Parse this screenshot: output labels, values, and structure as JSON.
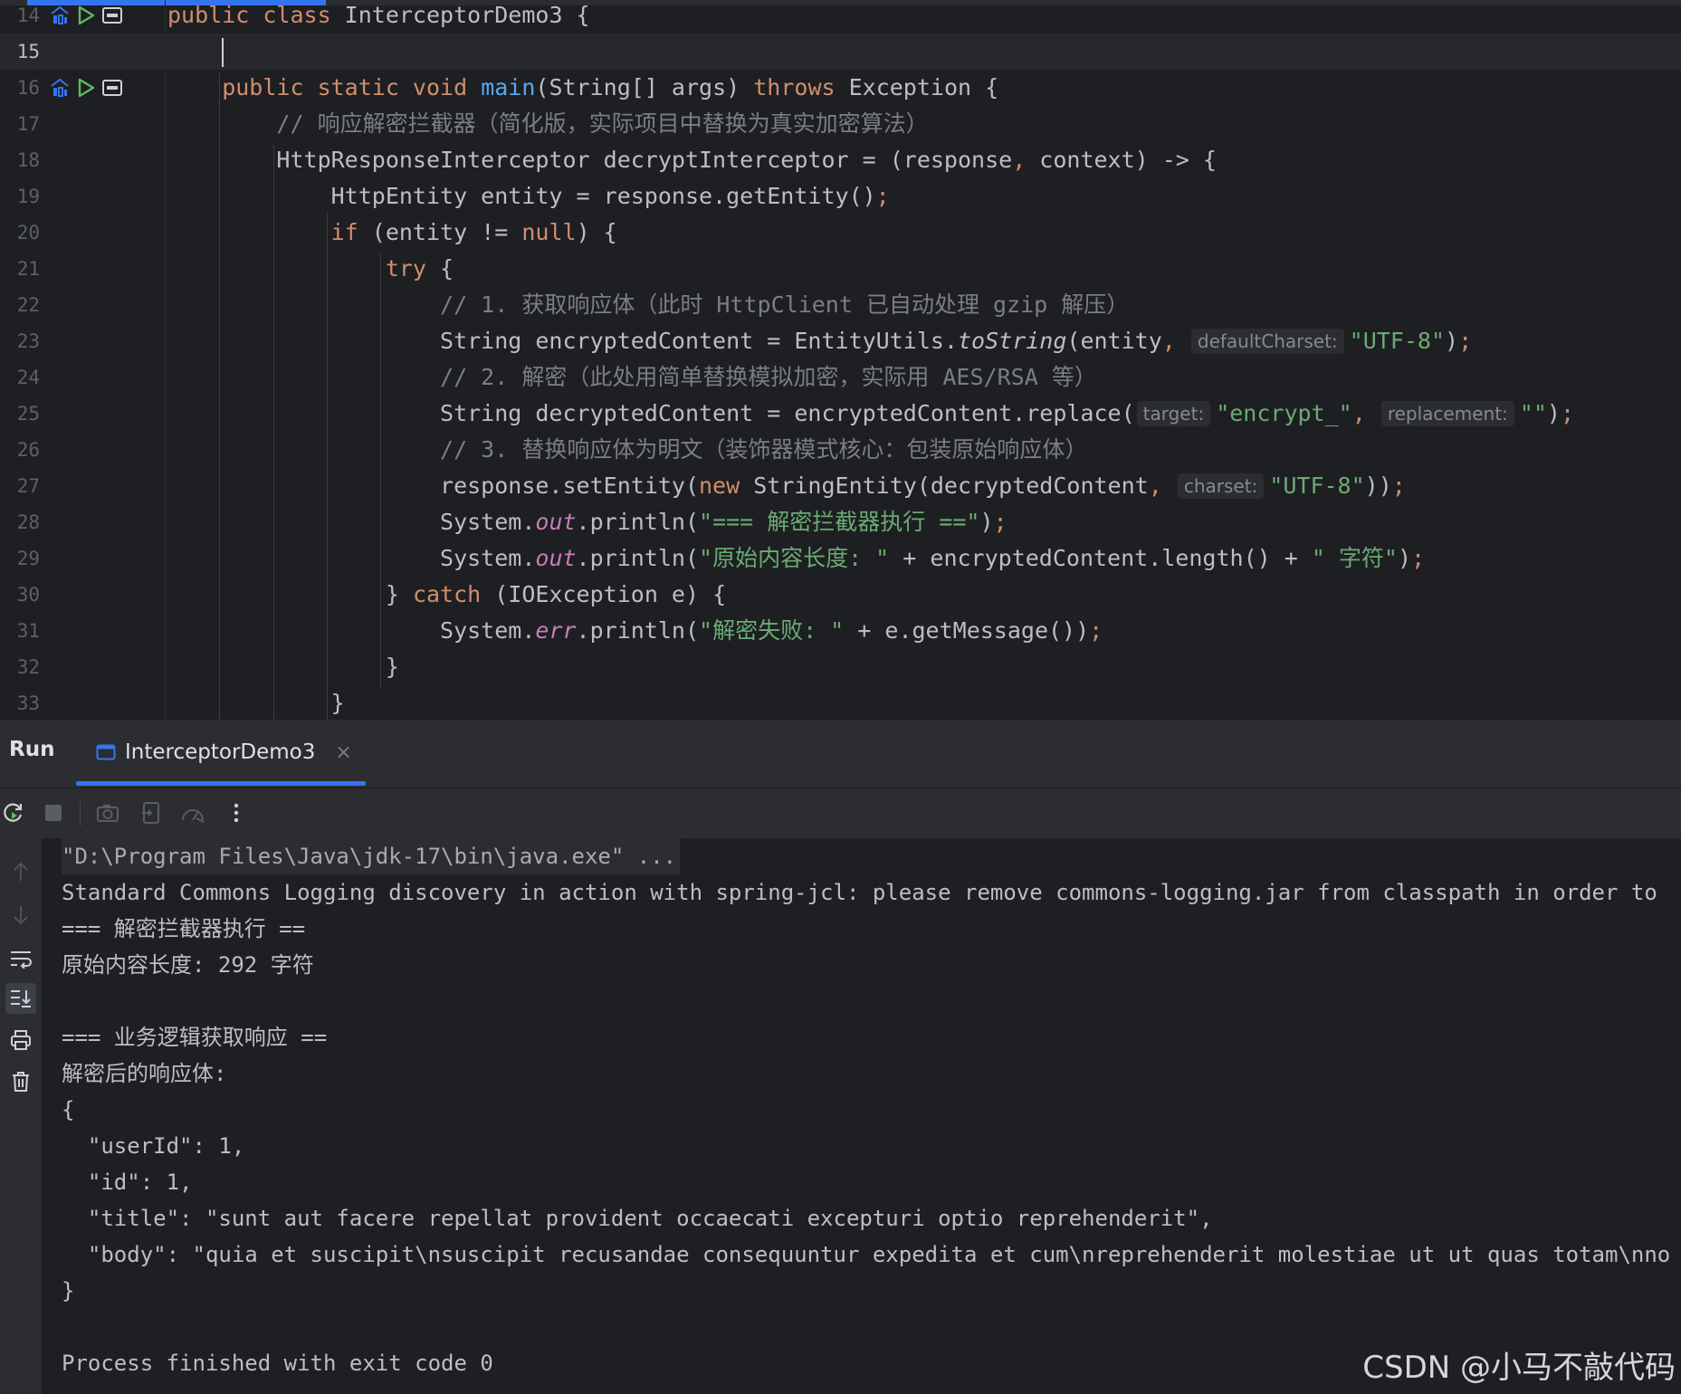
{
  "editor": {
    "lines": [
      {
        "num": "14",
        "tokens": [
          {
            "t": "public class ",
            "c": "kw"
          },
          {
            "t": "InterceptorDemo3 {",
            "c": ""
          }
        ],
        "icons": [
          "run-gutter-icon",
          "run-play-icon",
          "run-window-icon"
        ]
      },
      {
        "num": "15",
        "tokens": [],
        "current": true
      },
      {
        "num": "16",
        "tokens": [
          {
            "t": "    public static void ",
            "c": "kw"
          },
          {
            "t": "main",
            "c": "fn"
          },
          {
            "t": "(String[] args) ",
            "c": ""
          },
          {
            "t": "throws ",
            "c": "kw"
          },
          {
            "t": "Exception {",
            "c": ""
          }
        ],
        "icons": [
          "run-gutter-icon",
          "run-play-icon",
          "run-window-icon"
        ]
      },
      {
        "num": "17",
        "tokens": [
          {
            "t": "        // 响应解密拦截器（简化版，实际项目中替换为真实加密算法）",
            "c": "cmt"
          }
        ]
      },
      {
        "num": "18",
        "tokens": [
          {
            "t": "        HttpResponseInterceptor decryptInterceptor = (response",
            "c": ""
          },
          {
            "t": ", ",
            "c": "kw"
          },
          {
            "t": "context) -> {",
            "c": ""
          }
        ]
      },
      {
        "num": "19",
        "tokens": [
          {
            "t": "            HttpEntity entity = response.getEntity()",
            "c": ""
          },
          {
            "t": ";",
            "c": "kw"
          }
        ]
      },
      {
        "num": "20",
        "tokens": [
          {
            "t": "            if ",
            "c": "kw"
          },
          {
            "t": "(entity != ",
            "c": ""
          },
          {
            "t": "null",
            "c": "kw"
          },
          {
            "t": ") {",
            "c": ""
          }
        ]
      },
      {
        "num": "21",
        "tokens": [
          {
            "t": "                try ",
            "c": "kw"
          },
          {
            "t": "{",
            "c": ""
          }
        ]
      },
      {
        "num": "22",
        "tokens": [
          {
            "t": "                    // 1. 获取响应体（此时 HttpClient 已自动处理 gzip 解压）",
            "c": "cmt"
          }
        ]
      },
      {
        "num": "23",
        "tokens": [
          {
            "t": "                    String encryptedContent = EntityUtils.",
            "c": ""
          },
          {
            "t": "toString",
            "c": "ital"
          },
          {
            "t": "(entity",
            "c": ""
          },
          {
            "t": ", ",
            "c": "kw"
          },
          {
            "t": "defaultCharset:",
            "c": "hint"
          },
          {
            "t": "\"UTF-8\"",
            "c": "str"
          },
          {
            "t": ")",
            "c": ""
          },
          {
            "t": ";",
            "c": "kw"
          }
        ]
      },
      {
        "num": "24",
        "tokens": [
          {
            "t": "                    // 2. 解密（此处用简单替换模拟加密，实际用 AES/RSA 等）",
            "c": "cmt"
          }
        ]
      },
      {
        "num": "25",
        "tokens": [
          {
            "t": "                    String decryptedContent = encryptedContent.replace(",
            "c": ""
          },
          {
            "t": "target:",
            "c": "hint"
          },
          {
            "t": "\"encrypt_\"",
            "c": "str"
          },
          {
            "t": ", ",
            "c": "kw"
          },
          {
            "t": "replacement:",
            "c": "hint"
          },
          {
            "t": "\"\"",
            "c": "str"
          },
          {
            "t": ")",
            "c": ""
          },
          {
            "t": ";",
            "c": "kw"
          }
        ]
      },
      {
        "num": "26",
        "tokens": [
          {
            "t": "                    // 3. 替换响应体为明文（装饰器模式核心：包装原始响应体）",
            "c": "cmt"
          }
        ]
      },
      {
        "num": "27",
        "tokens": [
          {
            "t": "                    response.setEntity(",
            "c": ""
          },
          {
            "t": "new ",
            "c": "kw"
          },
          {
            "t": "StringEntity(decryptedContent",
            "c": ""
          },
          {
            "t": ", ",
            "c": "kw"
          },
          {
            "t": "charset:",
            "c": "hint"
          },
          {
            "t": "\"UTF-8\"",
            "c": "str"
          },
          {
            "t": "))",
            "c": ""
          },
          {
            "t": ";",
            "c": "kw"
          }
        ]
      },
      {
        "num": "28",
        "tokens": [
          {
            "t": "                    System.",
            "c": ""
          },
          {
            "t": "out",
            "c": "st"
          },
          {
            "t": ".println(",
            "c": ""
          },
          {
            "t": "\"=== 解密拦截器执行 ==\"",
            "c": "str"
          },
          {
            "t": ")",
            "c": ""
          },
          {
            "t": ";",
            "c": "kw"
          }
        ]
      },
      {
        "num": "29",
        "tokens": [
          {
            "t": "                    System.",
            "c": ""
          },
          {
            "t": "out",
            "c": "st"
          },
          {
            "t": ".println(",
            "c": ""
          },
          {
            "t": "\"原始内容长度: \"",
            "c": "str"
          },
          {
            "t": " + encryptedContent.length() + ",
            "c": ""
          },
          {
            "t": "\" 字符\"",
            "c": "str"
          },
          {
            "t": ")",
            "c": ""
          },
          {
            "t": ";",
            "c": "kw"
          }
        ]
      },
      {
        "num": "30",
        "tokens": [
          {
            "t": "                } ",
            "c": ""
          },
          {
            "t": "catch ",
            "c": "kw"
          },
          {
            "t": "(IOException e) {",
            "c": ""
          }
        ]
      },
      {
        "num": "31",
        "tokens": [
          {
            "t": "                    System.",
            "c": ""
          },
          {
            "t": "err",
            "c": "st"
          },
          {
            "t": ".println(",
            "c": ""
          },
          {
            "t": "\"解密失败: \"",
            "c": "str"
          },
          {
            "t": " + e.getMessage())",
            "c": ""
          },
          {
            "t": ";",
            "c": "kw"
          }
        ]
      },
      {
        "num": "32",
        "tokens": [
          {
            "t": "                }",
            "c": ""
          }
        ]
      },
      {
        "num": "33",
        "tokens": [
          {
            "t": "            }",
            "c": ""
          }
        ]
      }
    ]
  },
  "run_panel": {
    "title": "Run",
    "tab_label": "InterceptorDemo3",
    "tab_close": "×"
  },
  "console": {
    "lines": [
      {
        "text": "\"D:\\Program Files\\Java\\jdk-17\\bin\\java.exe\" ...",
        "kind": "cmd"
      },
      {
        "text": "Standard Commons Logging discovery in action with spring-jcl: please remove commons-logging.jar from classpath in order to"
      },
      {
        "text": "=== 解密拦截器执行 =="
      },
      {
        "text": "原始内容长度: 292 字符"
      },
      {
        "text": ""
      },
      {
        "text": "=== 业务逻辑获取响应 =="
      },
      {
        "text": "解密后的响应体:"
      },
      {
        "text": "{"
      },
      {
        "text": "  \"userId\": 1,"
      },
      {
        "text": "  \"id\": 1,"
      },
      {
        "text": "  \"title\": \"sunt aut facere repellat provident occaecati excepturi optio reprehenderit\","
      },
      {
        "text": "  \"body\": \"quia et suscipit\\nsuscipit recusandae consequuntur expedita et cum\\nreprehenderit molestiae ut ut quas totam\\nno"
      },
      {
        "text": "}"
      },
      {
        "text": ""
      },
      {
        "text": "Process finished with exit code 0"
      }
    ]
  },
  "watermark": "CSDN @小马不敲代码",
  "colors": {
    "keyword": "#cf8e6d",
    "function": "#56a8f5",
    "string": "#6aab73",
    "comment": "#7a7e85",
    "static_field": "#c77dbb",
    "accent": "#3574f0",
    "run_green": "#5fb865"
  }
}
